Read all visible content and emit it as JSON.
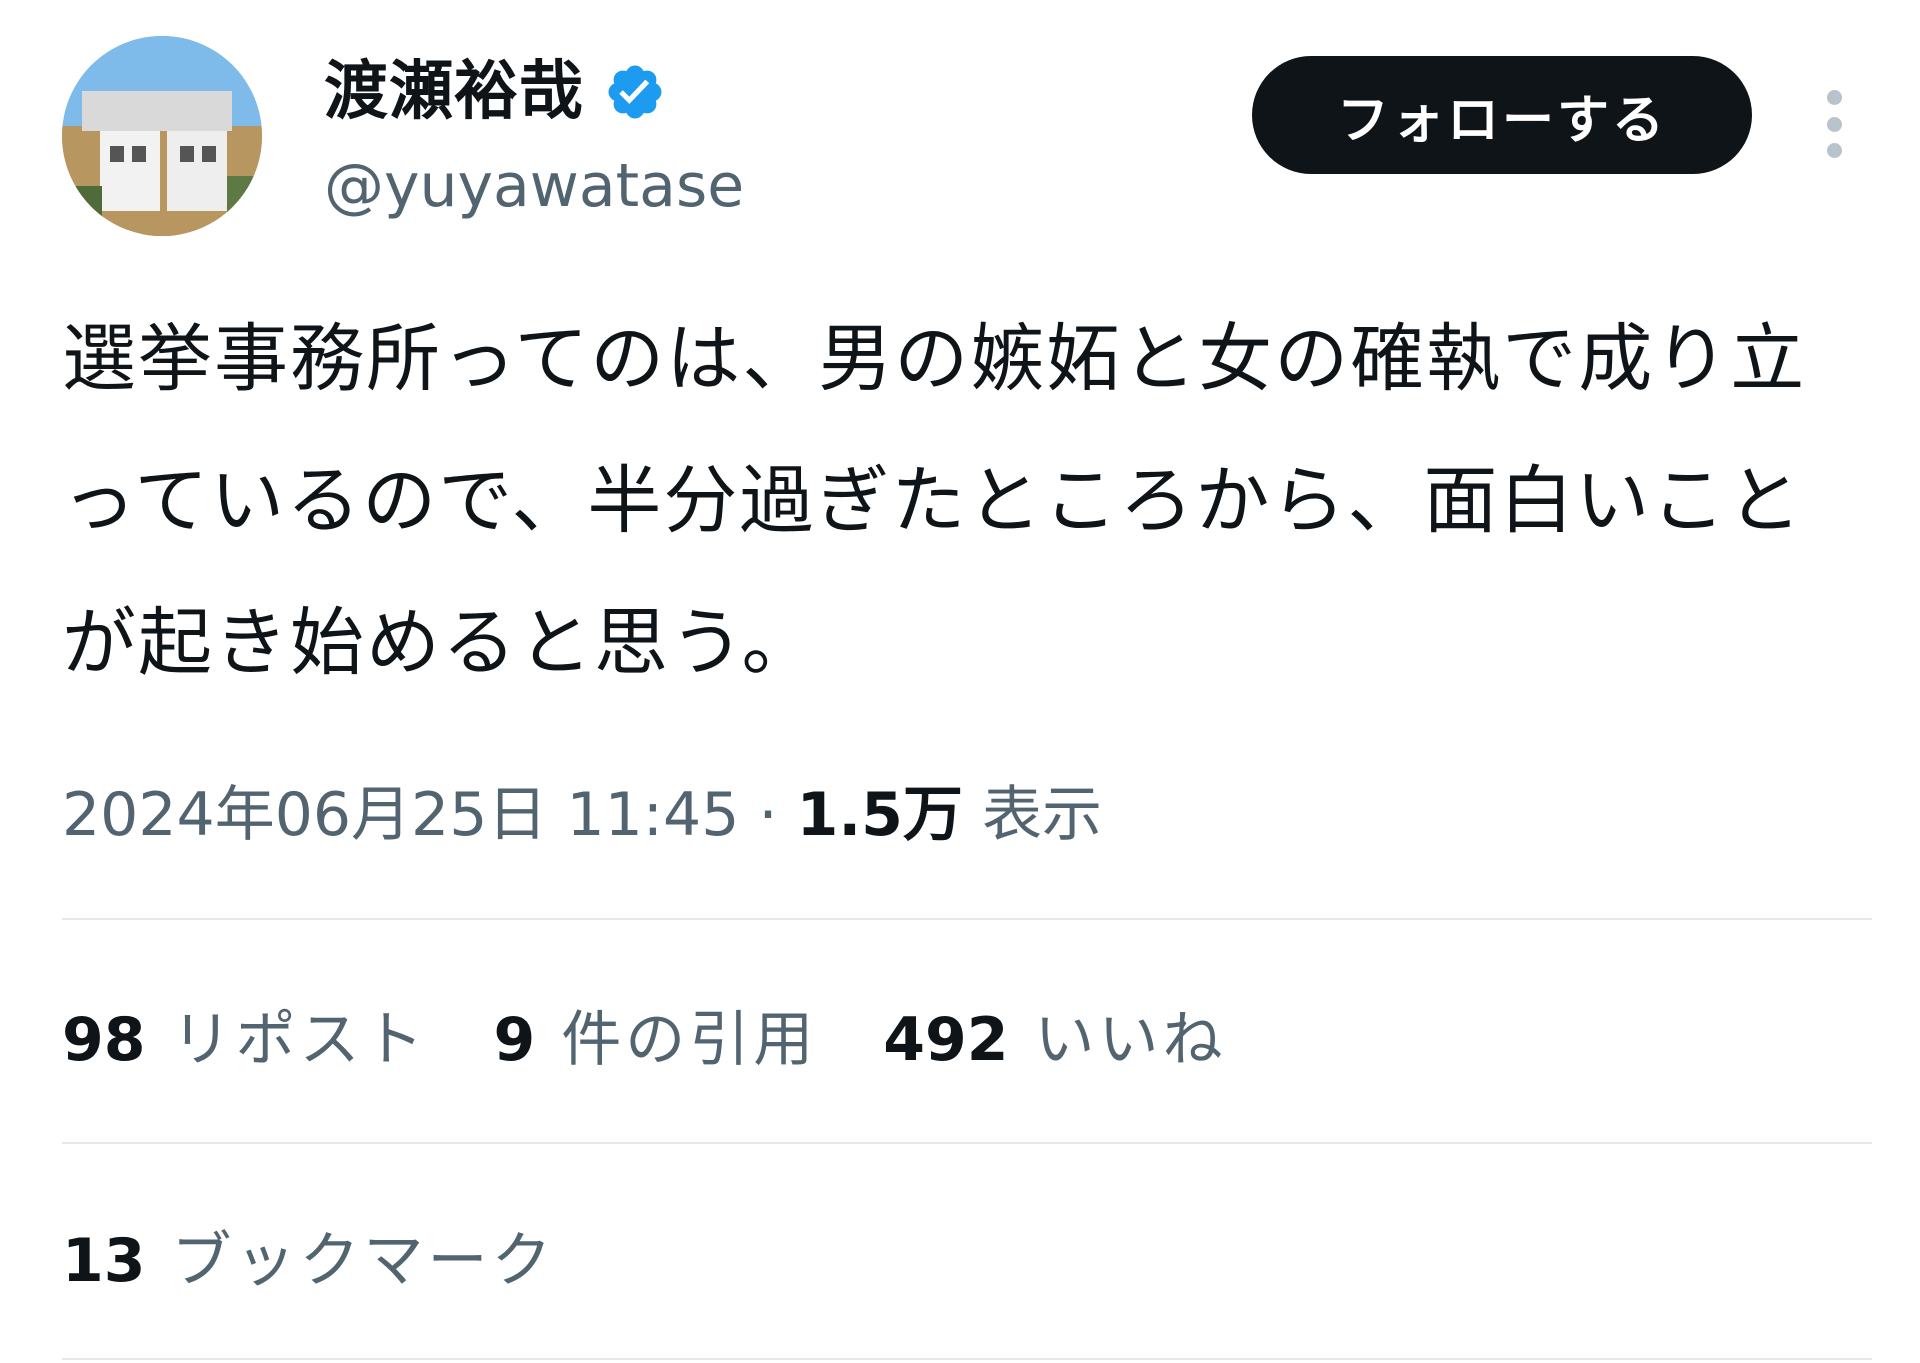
{
  "author": {
    "display_name": "渡瀬裕哉",
    "handle": "@yuyawatase",
    "verified_icon": "verified-badge-icon",
    "avatar_icon": "profile-photo"
  },
  "actions": {
    "follow_label": "フォローする",
    "more_icon": "more-vertical-icon"
  },
  "tweet": {
    "text": "選挙事務所ってのは、男の嫉妬と女の確執で成り立っているので、半分過ぎたところから、面白いことが起き始めると思う。"
  },
  "meta": {
    "datetime": "2024年06月25日 11:45",
    "separator": "·",
    "views_count": "1.5万",
    "views_label": "表示"
  },
  "stats": {
    "reposts": {
      "count": "98",
      "label": "リポスト"
    },
    "quotes": {
      "count": "9",
      "label": "件の引用"
    },
    "likes": {
      "count": "492",
      "label": "いいね"
    }
  },
  "bookmarks": {
    "count": "13",
    "label": "ブックマーク"
  },
  "colors": {
    "text": "#0f1419",
    "secondary": "#536471",
    "divider": "#e4e8eb",
    "verified": "#1d9bf0",
    "button_bg": "#0f1419"
  }
}
